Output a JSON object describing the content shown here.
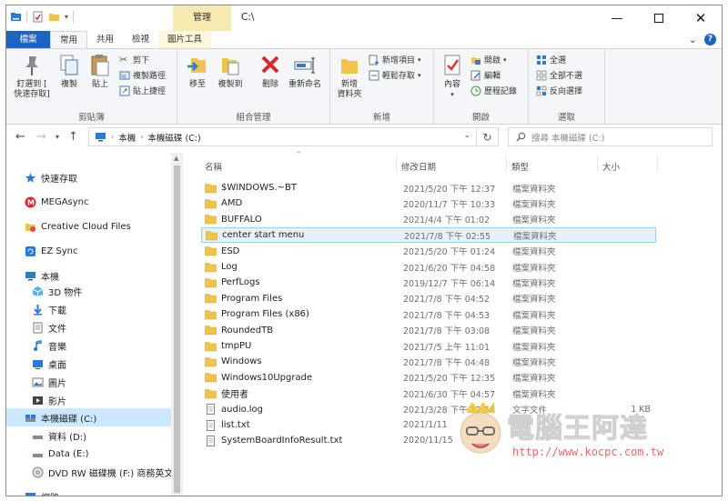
{
  "window": {
    "context_tab": "管理",
    "title": "C:\\"
  },
  "tabs": {
    "file": "檔案",
    "home": "常用",
    "share": "共用",
    "view": "檢視",
    "picture_tools": "圖片工具"
  },
  "ribbon": {
    "clipboard": {
      "label": "剪貼簿",
      "pin": "釘選到 [\n快速存取]",
      "copy": "複製",
      "paste": "貼上",
      "cut": "剪下",
      "copy_path": "複製路徑",
      "paste_shortcut": "貼上捷徑"
    },
    "organize": {
      "label": "組合管理",
      "move_to": "移至",
      "copy_to": "複製到",
      "delete": "刪除",
      "rename": "重新命名"
    },
    "new": {
      "label": "新增",
      "new_folder": "新增\n資料夾",
      "new_item": "新增項目",
      "easy_access": "輕鬆存取"
    },
    "open": {
      "label": "開啟",
      "properties": "內容",
      "open": "開啟",
      "edit": "編輯",
      "history": "歷程記錄"
    },
    "select": {
      "label": "選取",
      "select_all": "全選",
      "select_none": "全部不選",
      "invert": "反向選擇"
    }
  },
  "address": {
    "crumbs": [
      "本機",
      "本機磁碟 (C:)"
    ],
    "search_placeholder": "搜尋 本機磁碟 (C:)"
  },
  "nav": {
    "items": [
      {
        "label": "快速存取",
        "icon": "star-icon"
      },
      {
        "label": "MEGAsync",
        "icon": "mega-icon"
      },
      {
        "label": "Creative Cloud Files",
        "icon": "creative-cloud-icon"
      },
      {
        "label": "EZ Sync",
        "icon": "ez-sync-icon"
      },
      {
        "label": "本機",
        "icon": "computer-icon"
      },
      {
        "label": "3D 物件",
        "icon": "3d-objects-icon"
      },
      {
        "label": "下載",
        "icon": "download-icon"
      },
      {
        "label": "文件",
        "icon": "documents-icon"
      },
      {
        "label": "音樂",
        "icon": "music-icon"
      },
      {
        "label": "桌面",
        "icon": "desktop-icon"
      },
      {
        "label": "圖片",
        "icon": "pictures-icon"
      },
      {
        "label": "影片",
        "icon": "videos-icon"
      },
      {
        "label": "本機磁碟 (C:)",
        "icon": "drive-icon"
      },
      {
        "label": "資料 (D:)",
        "icon": "drive-icon"
      },
      {
        "label": "Data (E:)",
        "icon": "drive-icon"
      },
      {
        "label": "DVD RW 磁碟機 (F:) 商務英文",
        "icon": "dvd-icon"
      },
      {
        "label": "網路",
        "icon": "network-icon"
      }
    ]
  },
  "list": {
    "headers": {
      "name": "名稱",
      "date": "修改日期",
      "type": "類型",
      "size": "大小"
    },
    "rows": [
      {
        "name": "$WINDOWS.~BT",
        "date": "2021/5/20 下午 12:37",
        "type": "檔案資料夾",
        "size": "",
        "kind": "folder"
      },
      {
        "name": "AMD",
        "date": "2020/11/7 下午 10:33",
        "type": "檔案資料夾",
        "size": "",
        "kind": "folder"
      },
      {
        "name": "BUFFALO",
        "date": "2021/4/4 下午 01:02",
        "type": "檔案資料夾",
        "size": "",
        "kind": "folder"
      },
      {
        "name": "center start menu",
        "date": "2021/7/8 下午 02:55",
        "type": "檔案資料夾",
        "size": "",
        "kind": "folder"
      },
      {
        "name": "ESD",
        "date": "2021/5/20 下午 01:24",
        "type": "檔案資料夾",
        "size": "",
        "kind": "folder"
      },
      {
        "name": "Log",
        "date": "2021/6/20 下午 04:58",
        "type": "檔案資料夾",
        "size": "",
        "kind": "folder"
      },
      {
        "name": "PerfLogs",
        "date": "2019/12/7 下午 06:14",
        "type": "檔案資料夾",
        "size": "",
        "kind": "folder"
      },
      {
        "name": "Program Files",
        "date": "2021/7/8 下午 04:52",
        "type": "檔案資料夾",
        "size": "",
        "kind": "folder"
      },
      {
        "name": "Program Files (x86)",
        "date": "2021/7/8 下午 04:53",
        "type": "檔案資料夾",
        "size": "",
        "kind": "folder"
      },
      {
        "name": "RoundedTB",
        "date": "2021/7/8 下午 03:08",
        "type": "檔案資料夾",
        "size": "",
        "kind": "folder"
      },
      {
        "name": "tmpPU",
        "date": "2021/7/5 上午 11:01",
        "type": "檔案資料夾",
        "size": "",
        "kind": "folder"
      },
      {
        "name": "Windows",
        "date": "2021/7/8 下午 04:48",
        "type": "檔案資料夾",
        "size": "",
        "kind": "folder"
      },
      {
        "name": "Windows10Upgrade",
        "date": "2021/5/20 下午 12:35",
        "type": "檔案資料夾",
        "size": "",
        "kind": "folder"
      },
      {
        "name": "使用者",
        "date": "2021/6/30 下午 04:57",
        "type": "檔案資料夾",
        "size": "",
        "kind": "folder"
      },
      {
        "name": "audio.log",
        "date": "2021/3/28 下午 12:58",
        "type": "文字文件",
        "size": "1 KB",
        "kind": "file"
      },
      {
        "name": "list.txt",
        "date": "2021/1/11",
        "type": "",
        "size": "",
        "kind": "file"
      },
      {
        "name": "SystemBoardInfoResult.txt",
        "date": "2020/11/15",
        "type": "",
        "size": "",
        "kind": "file"
      }
    ]
  },
  "watermark": {
    "text": "電腦王阿達",
    "url": "http://www.kocpc.com.tw"
  },
  "colors": {
    "accent": "#1a65c0",
    "selection": "#cce8ff",
    "folder": "#f0c34d"
  }
}
